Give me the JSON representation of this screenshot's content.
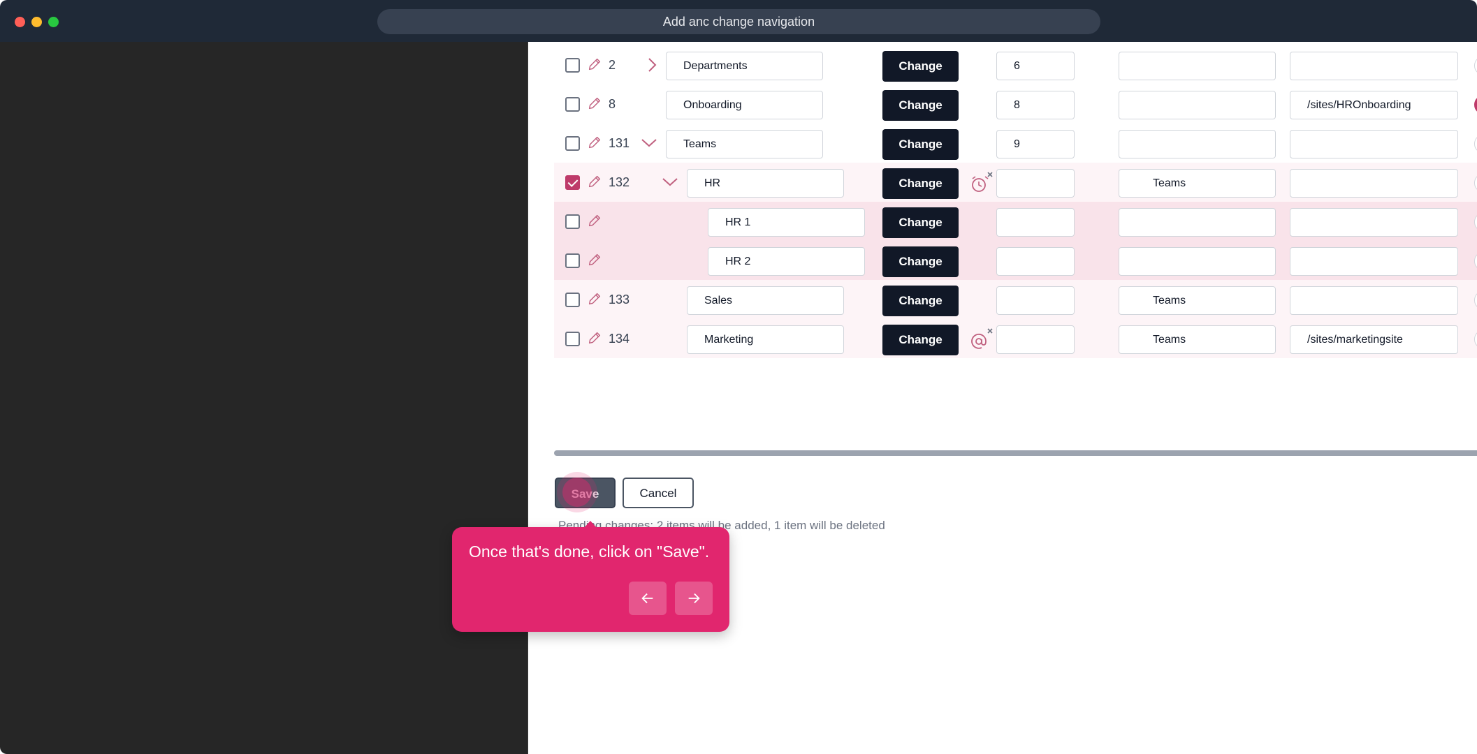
{
  "window": {
    "title": "Add anc change navigation"
  },
  "rows": [
    {
      "num": "2",
      "name": "Departments",
      "change_label": "Change",
      "order": "6",
      "parent": "",
      "path": ""
    },
    {
      "num": "8",
      "name": "Onboarding",
      "change_label": "Change",
      "order": "8",
      "parent": "",
      "path": "/sites/HROnboarding"
    },
    {
      "num": "131",
      "name": "Teams",
      "change_label": "Change",
      "order": "9",
      "parent": "",
      "path": ""
    },
    {
      "num": "132",
      "name": "HR",
      "change_label": "Change",
      "order": "",
      "parent": "Teams",
      "path": ""
    },
    {
      "num": "",
      "name": "HR 1",
      "change_label": "Change",
      "order": "",
      "parent": "",
      "path": ""
    },
    {
      "num": "",
      "name": "HR 2",
      "change_label": "Change",
      "order": "",
      "parent": "",
      "path": ""
    },
    {
      "num": "133",
      "name": "Sales",
      "change_label": "Change",
      "order": "",
      "parent": "Teams",
      "path": ""
    },
    {
      "num": "134",
      "name": "Marketing",
      "change_label": "Change",
      "order": "",
      "parent": "Teams",
      "path": "/sites/marketingsite"
    }
  ],
  "actions": {
    "save_label": "Save",
    "cancel_label": "Cancel",
    "pending_text": "Pending changes: 2 items will be added, 1 item will be deleted"
  },
  "tooltip": {
    "text": "Once that's done, click on \"Save\"."
  },
  "colors": {
    "accent": "#e1266e",
    "button_dark": "#111827",
    "checked": "#be3a6a"
  }
}
